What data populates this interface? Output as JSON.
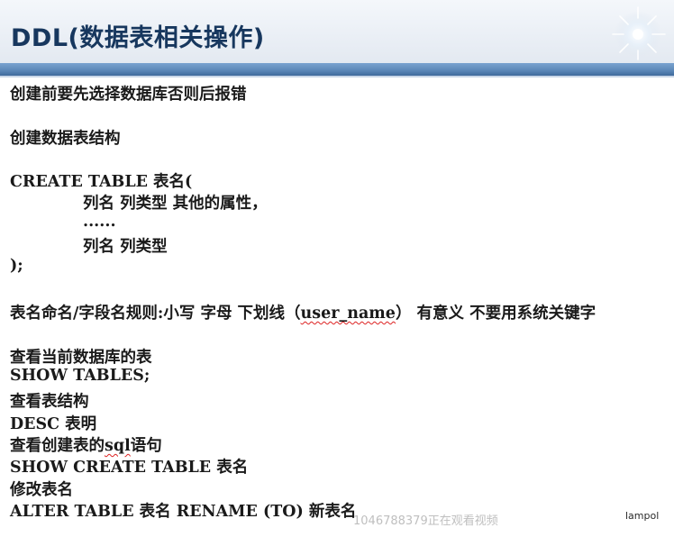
{
  "slide": {
    "title": "DDL(数据表相关操作)",
    "brand": "lampol",
    "watermark": "1046788379正在观看视频",
    "lines": {
      "l1": "创建前要先选择数据库否则后报错",
      "l2": "创建数据表结构",
      "l3": "CREATE TABLE 表名(",
      "l4": "列名 列类型  其他的属性，",
      "l5": "......",
      "l6": "列名 列类型",
      "l7": ");",
      "l8a": "表名命名/字段名规则:小写 字母 下划线（",
      "l8b": "user_name",
      "l8c": "）  有意义  不要用系统关键字",
      "l9": "查看当前数据库的表",
      "l10": "SHOW TABLES;",
      "l11": "查看表结构",
      "l12": "DESC  表明",
      "l13a": "查看创建表的",
      "l13b": "sql",
      "l13c": "语句",
      "l14": "SHOW CREATE TABLE 表名",
      "l15": "修改表名",
      "l16": "ALTER TABLE 表名  RENAME (TO) 新表名"
    }
  }
}
